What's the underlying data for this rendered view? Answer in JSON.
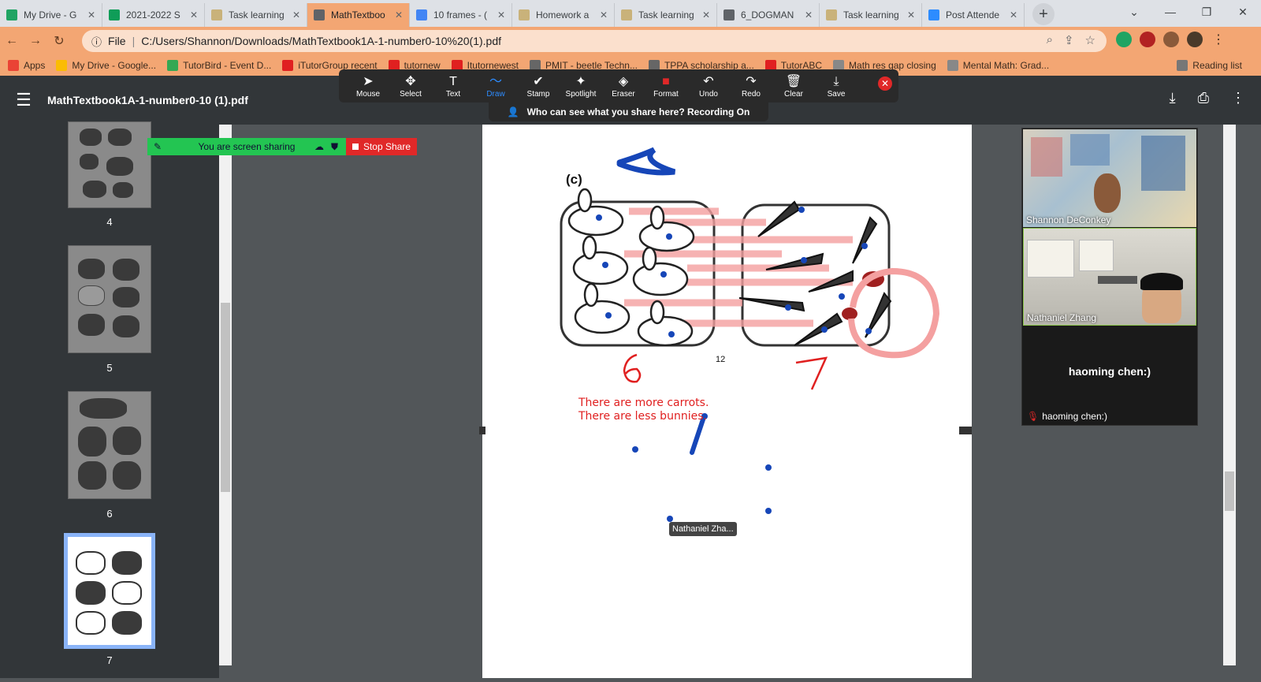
{
  "tabs": [
    {
      "label": "My Drive - G",
      "color": "#1fa463"
    },
    {
      "label": "2021-2022 S",
      "color": "#0f9d58"
    },
    {
      "label": "Task learning",
      "color": "#c9b27a"
    },
    {
      "label": "MathTextboo",
      "color": "#5f6368",
      "active": true
    },
    {
      "label": "10 frames - (",
      "color": "#4285f4"
    },
    {
      "label": "Homework a",
      "color": "#c9b27a"
    },
    {
      "label": "Task learning",
      "color": "#c9b27a"
    },
    {
      "label": "6_DOGMAN",
      "color": "#5f6368"
    },
    {
      "label": "Task learning",
      "color": "#c9b27a"
    },
    {
      "label": "Post Attende",
      "color": "#2d8cff"
    }
  ],
  "address": {
    "scheme": "File",
    "url": "C:/Users/Shannon/Downloads/MathTextbook1A-1-number0-10%20(1).pdf"
  },
  "bookmarks": [
    {
      "label": "Apps",
      "color": "#ea4335"
    },
    {
      "label": "My Drive - Google...",
      "color": "#fbbc04"
    },
    {
      "label": "TutorBird - Event D...",
      "color": "#34a853"
    },
    {
      "label": "iTutorGroup recent",
      "color": "#e02020"
    },
    {
      "label": "tutornew",
      "color": "#e02020"
    },
    {
      "label": "Itutornewest",
      "color": "#e02020"
    },
    {
      "label": "PMIT - beetle Techn...",
      "color": "#666666"
    },
    {
      "label": "TPPA scholarship a...",
      "color": "#666666"
    },
    {
      "label": "TutorABC",
      "color": "#e02020"
    },
    {
      "label": "Math res gap closing",
      "color": "#888888"
    },
    {
      "label": "Mental Math: Grad...",
      "color": "#888888"
    },
    {
      "label": "Reading list",
      "color": "#777777"
    }
  ],
  "annotation_tools": [
    {
      "label": "Mouse",
      "icon": "cursor-icon",
      "glyph": "➤"
    },
    {
      "label": "Select",
      "icon": "move-icon",
      "glyph": "✥"
    },
    {
      "label": "Text",
      "icon": "text-icon",
      "glyph": "T"
    },
    {
      "label": "Draw",
      "icon": "draw-icon",
      "glyph": "〜",
      "active": true
    },
    {
      "label": "Stamp",
      "icon": "check-icon",
      "glyph": "✔"
    },
    {
      "label": "Spotlight",
      "icon": "spotlight-icon",
      "glyph": "✦"
    },
    {
      "label": "Eraser",
      "icon": "eraser-icon",
      "glyph": "◈"
    },
    {
      "label": "Format",
      "icon": "format-icon",
      "glyph": "■"
    },
    {
      "label": "Undo",
      "icon": "undo-icon",
      "glyph": "↶"
    },
    {
      "label": "Redo",
      "icon": "redo-icon",
      "glyph": "↷"
    },
    {
      "label": "Clear",
      "icon": "trash-icon",
      "glyph": "🗑"
    },
    {
      "label": "Save",
      "icon": "save-icon",
      "glyph": "⤓"
    }
  ],
  "recording_banner": "Who can see what you share here? Recording On",
  "pdf": {
    "title": "MathTextbook1A-1-number0-10 (1).pdf",
    "pages": [
      "4",
      "5",
      "6",
      "7"
    ],
    "page_number": "12",
    "section_label": "(c)",
    "left_count": "6",
    "right_count": "7",
    "text_line1": "There are more carrots.",
    "text_line2": "There are less bunnies."
  },
  "share": {
    "label": "You are screen sharing",
    "stop_label": "Stop Share"
  },
  "participants": [
    {
      "name": "Shannon DeConkey"
    },
    {
      "name": "Nathaniel Zhang"
    },
    {
      "name": "haoming chen:)"
    }
  ],
  "cursor_label": "Nathaniel Zha..."
}
